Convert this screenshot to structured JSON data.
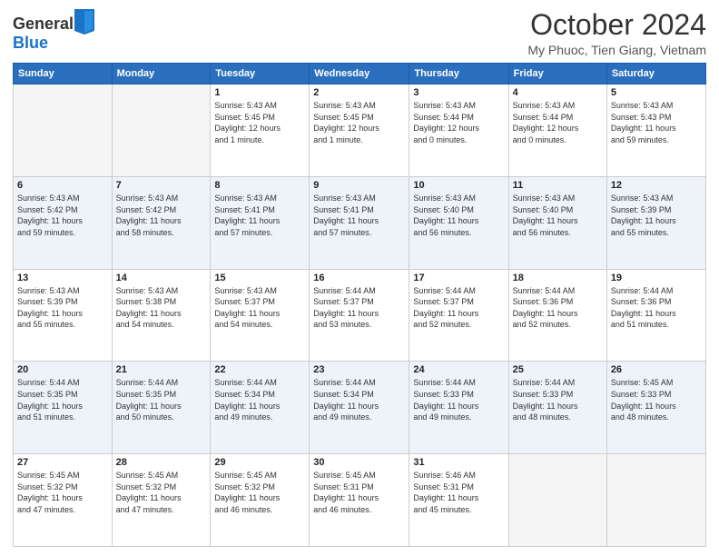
{
  "header": {
    "logo_general": "General",
    "logo_blue": "Blue",
    "title": "October 2024",
    "subtitle": "My Phuoc, Tien Giang, Vietnam"
  },
  "weekdays": [
    "Sunday",
    "Monday",
    "Tuesday",
    "Wednesday",
    "Thursday",
    "Friday",
    "Saturday"
  ],
  "weeks": [
    [
      {
        "day": "",
        "info": ""
      },
      {
        "day": "",
        "info": ""
      },
      {
        "day": "1",
        "info": "Sunrise: 5:43 AM\nSunset: 5:45 PM\nDaylight: 12 hours\nand 1 minute."
      },
      {
        "day": "2",
        "info": "Sunrise: 5:43 AM\nSunset: 5:45 PM\nDaylight: 12 hours\nand 1 minute."
      },
      {
        "day": "3",
        "info": "Sunrise: 5:43 AM\nSunset: 5:44 PM\nDaylight: 12 hours\nand 0 minutes."
      },
      {
        "day": "4",
        "info": "Sunrise: 5:43 AM\nSunset: 5:44 PM\nDaylight: 12 hours\nand 0 minutes."
      },
      {
        "day": "5",
        "info": "Sunrise: 5:43 AM\nSunset: 5:43 PM\nDaylight: 11 hours\nand 59 minutes."
      }
    ],
    [
      {
        "day": "6",
        "info": "Sunrise: 5:43 AM\nSunset: 5:42 PM\nDaylight: 11 hours\nand 59 minutes."
      },
      {
        "day": "7",
        "info": "Sunrise: 5:43 AM\nSunset: 5:42 PM\nDaylight: 11 hours\nand 58 minutes."
      },
      {
        "day": "8",
        "info": "Sunrise: 5:43 AM\nSunset: 5:41 PM\nDaylight: 11 hours\nand 57 minutes."
      },
      {
        "day": "9",
        "info": "Sunrise: 5:43 AM\nSunset: 5:41 PM\nDaylight: 11 hours\nand 57 minutes."
      },
      {
        "day": "10",
        "info": "Sunrise: 5:43 AM\nSunset: 5:40 PM\nDaylight: 11 hours\nand 56 minutes."
      },
      {
        "day": "11",
        "info": "Sunrise: 5:43 AM\nSunset: 5:40 PM\nDaylight: 11 hours\nand 56 minutes."
      },
      {
        "day": "12",
        "info": "Sunrise: 5:43 AM\nSunset: 5:39 PM\nDaylight: 11 hours\nand 55 minutes."
      }
    ],
    [
      {
        "day": "13",
        "info": "Sunrise: 5:43 AM\nSunset: 5:39 PM\nDaylight: 11 hours\nand 55 minutes."
      },
      {
        "day": "14",
        "info": "Sunrise: 5:43 AM\nSunset: 5:38 PM\nDaylight: 11 hours\nand 54 minutes."
      },
      {
        "day": "15",
        "info": "Sunrise: 5:43 AM\nSunset: 5:37 PM\nDaylight: 11 hours\nand 54 minutes."
      },
      {
        "day": "16",
        "info": "Sunrise: 5:44 AM\nSunset: 5:37 PM\nDaylight: 11 hours\nand 53 minutes."
      },
      {
        "day": "17",
        "info": "Sunrise: 5:44 AM\nSunset: 5:37 PM\nDaylight: 11 hours\nand 52 minutes."
      },
      {
        "day": "18",
        "info": "Sunrise: 5:44 AM\nSunset: 5:36 PM\nDaylight: 11 hours\nand 52 minutes."
      },
      {
        "day": "19",
        "info": "Sunrise: 5:44 AM\nSunset: 5:36 PM\nDaylight: 11 hours\nand 51 minutes."
      }
    ],
    [
      {
        "day": "20",
        "info": "Sunrise: 5:44 AM\nSunset: 5:35 PM\nDaylight: 11 hours\nand 51 minutes."
      },
      {
        "day": "21",
        "info": "Sunrise: 5:44 AM\nSunset: 5:35 PM\nDaylight: 11 hours\nand 50 minutes."
      },
      {
        "day": "22",
        "info": "Sunrise: 5:44 AM\nSunset: 5:34 PM\nDaylight: 11 hours\nand 49 minutes."
      },
      {
        "day": "23",
        "info": "Sunrise: 5:44 AM\nSunset: 5:34 PM\nDaylight: 11 hours\nand 49 minutes."
      },
      {
        "day": "24",
        "info": "Sunrise: 5:44 AM\nSunset: 5:33 PM\nDaylight: 11 hours\nand 49 minutes."
      },
      {
        "day": "25",
        "info": "Sunrise: 5:44 AM\nSunset: 5:33 PM\nDaylight: 11 hours\nand 48 minutes."
      },
      {
        "day": "26",
        "info": "Sunrise: 5:45 AM\nSunset: 5:33 PM\nDaylight: 11 hours\nand 48 minutes."
      }
    ],
    [
      {
        "day": "27",
        "info": "Sunrise: 5:45 AM\nSunset: 5:32 PM\nDaylight: 11 hours\nand 47 minutes."
      },
      {
        "day": "28",
        "info": "Sunrise: 5:45 AM\nSunset: 5:32 PM\nDaylight: 11 hours\nand 47 minutes."
      },
      {
        "day": "29",
        "info": "Sunrise: 5:45 AM\nSunset: 5:32 PM\nDaylight: 11 hours\nand 46 minutes."
      },
      {
        "day": "30",
        "info": "Sunrise: 5:45 AM\nSunset: 5:31 PM\nDaylight: 11 hours\nand 46 minutes."
      },
      {
        "day": "31",
        "info": "Sunrise: 5:46 AM\nSunset: 5:31 PM\nDaylight: 11 hours\nand 45 minutes."
      },
      {
        "day": "",
        "info": ""
      },
      {
        "day": "",
        "info": ""
      }
    ]
  ]
}
